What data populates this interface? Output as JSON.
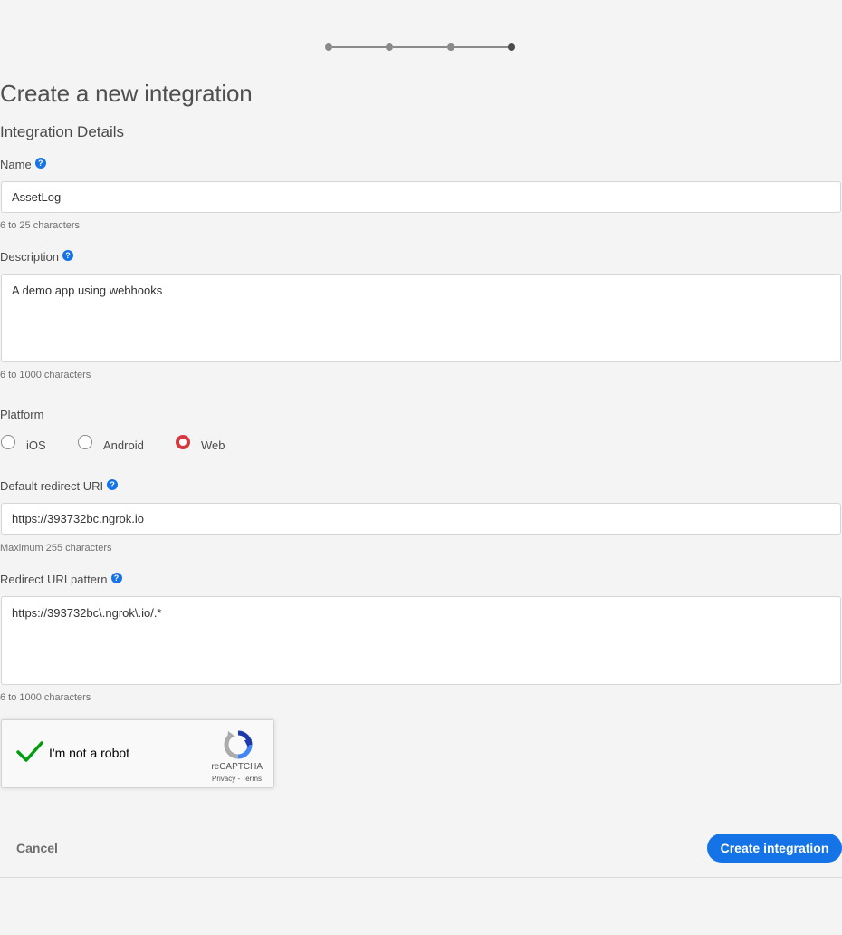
{
  "stepper": {
    "total_steps": 4,
    "current_step": 4
  },
  "header": {
    "title": "Create a new integration",
    "section_title": "Integration Details"
  },
  "form": {
    "name": {
      "label": "Name",
      "value": "AssetLog",
      "hint": "6 to 25 characters"
    },
    "description": {
      "label": "Description",
      "value": "A demo app using webhooks",
      "hint": "6 to 1000 characters"
    },
    "platform": {
      "label": "Platform",
      "options": [
        "iOS",
        "Android",
        "Web"
      ],
      "selected": "Web"
    },
    "redirect_uri": {
      "label": "Default redirect URI",
      "value": "https://393732bc.ngrok.io",
      "hint": "Maximum 255 characters"
    },
    "redirect_pattern": {
      "label": "Redirect URI pattern",
      "value": "https://393732bc\\.ngrok\\.io/.*",
      "hint": "6 to 1000 characters"
    },
    "help_glyph": "?"
  },
  "recaptcha": {
    "label": "I'm not a robot",
    "brand": "reCAPTCHA",
    "links": "Privacy - Terms",
    "checked": true
  },
  "footer": {
    "cancel_label": "Cancel",
    "create_label": "Create integration"
  },
  "colors": {
    "accent": "#1473e6",
    "radio_selected": "#d7373f",
    "check_green": "#009e0f"
  }
}
